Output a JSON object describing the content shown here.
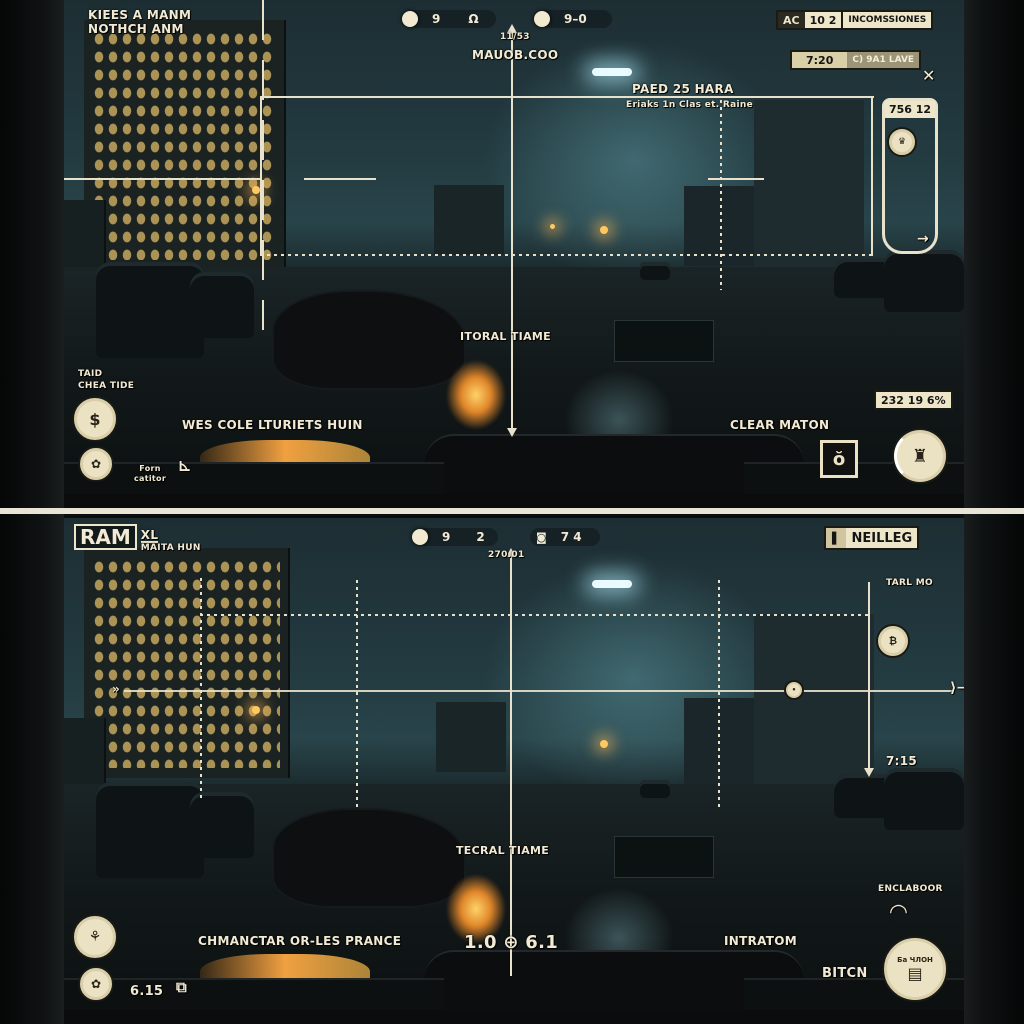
{
  "top_view": {
    "header_title_line1": "KIEES A MANM",
    "header_title_line2": "NOTHCH ANM",
    "stat_pill_1": {
      "value_a": "9",
      "value_b": "Ω"
    },
    "stat_pill_2": {
      "value": "9–0"
    },
    "heading_value": "11/53",
    "heading_label": "MAUOB.COO",
    "status_tag": {
      "code": "AC",
      "value": "10 2",
      "label": "INCOMSSIONES"
    },
    "timer_tag": {
      "value": "7:20",
      "label": "C) 9A1 LAVE"
    },
    "close_label": "✕",
    "target_title": "PAED 25 HARA",
    "target_subtitle": "Eriaks 1n  Clas et. Raine",
    "side_gauge": {
      "value": "756 12",
      "arrow": "→"
    },
    "center_label": "ITORAL TIAME",
    "left_status_line1": "TAID",
    "left_status_line2": "CHEA TIDE",
    "objective_text": "WES COLE LTURIETS HUIN",
    "small_label_line1": "Forn",
    "small_label_line2": "catitor",
    "percent_readout": "232 19 6%",
    "action_label": "CLEAR MATON"
  },
  "bottom_view": {
    "badge_main": "RAM",
    "badge_sub": "XL",
    "badge_caption": "MAITA HUN",
    "stat_pill_1": {
      "value_a": "9",
      "value_b": "2"
    },
    "stat_pill_2": {
      "value": "7 4"
    },
    "heading_value": "270.01",
    "name_tag": {
      "label": "NEILLEG"
    },
    "side_label": "TARL MO",
    "side_time": "7:15",
    "center_label": "TECRAL TIAME",
    "center_readout": "1.0 ⊕ 6.1",
    "objective_text": "CHMANCTAR OR-LES PRANCE",
    "left_value": "6.15",
    "action_label": "INTRATOM",
    "secondary_label": "BITCN",
    "top_right_label": "ENCLABOOR",
    "round_icon_caption": "Ба ЧЛОН"
  },
  "colors": {
    "hud": "#e8e2cc",
    "hud_cream": "#eee6c9",
    "sky": "#223a40",
    "fire": "#f0a040"
  }
}
